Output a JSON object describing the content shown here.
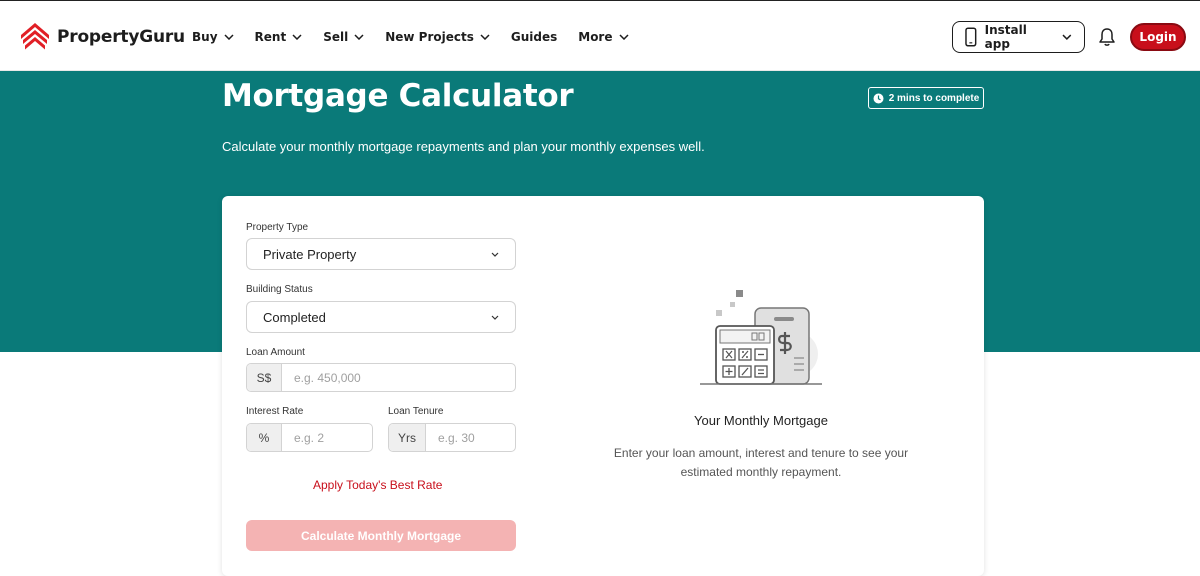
{
  "brand": {
    "name": "PropertyGuru",
    "color": "#e11f26"
  },
  "nav": {
    "items": [
      {
        "label": "Buy",
        "dropdown": true
      },
      {
        "label": "Rent",
        "dropdown": true
      },
      {
        "label": "Sell",
        "dropdown": true
      },
      {
        "label": "New Projects",
        "dropdown": true
      },
      {
        "label": "Guides",
        "dropdown": false
      },
      {
        "label": "More",
        "dropdown": true
      }
    ],
    "install_label": "Install app",
    "login_label": "Login"
  },
  "hero": {
    "title": "Mortgage Calculator",
    "badge": "2 mins to complete",
    "subtitle": "Calculate your monthly mortgage repayments and plan your monthly expenses well.",
    "bg_color": "#0a7a79"
  },
  "form": {
    "property_type": {
      "label": "Property Type",
      "value": "Private Property"
    },
    "building_status": {
      "label": "Building Status",
      "value": "Completed"
    },
    "loan_amount": {
      "label": "Loan Amount",
      "prefix": "S$",
      "placeholder": "e.g. 450,000"
    },
    "interest_rate": {
      "label": "Interest Rate",
      "prefix": "%",
      "placeholder": "e.g. 2"
    },
    "loan_tenure": {
      "label": "Loan Tenure",
      "prefix": "Yrs",
      "placeholder": "e.g. 30"
    },
    "best_rate_link": "Apply Today's Best Rate",
    "submit_label": "Calculate Monthly Mortgage"
  },
  "result": {
    "title": "Your Monthly Mortgage",
    "description": "Enter your loan amount, interest and tenure to see your estimated monthly repayment."
  },
  "icons": {
    "logo": "propertyguru-logo-icon",
    "chevron": "chevron-down-icon",
    "phone": "phone-icon",
    "bell": "bell-icon",
    "clock": "clock-icon",
    "calculator": "calculator-illustration"
  }
}
